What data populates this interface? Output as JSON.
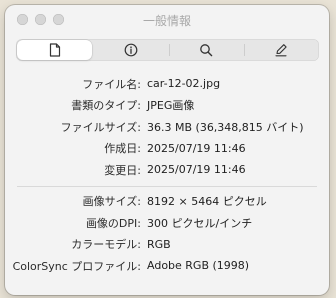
{
  "window": {
    "title": "一般情報"
  },
  "tabs": [
    {
      "name": "document",
      "icon": "document-icon"
    },
    {
      "name": "info",
      "icon": "info-icon"
    },
    {
      "name": "search",
      "icon": "magnifier-icon"
    },
    {
      "name": "edit",
      "icon": "pencil-icon"
    }
  ],
  "file_info": [
    {
      "label": "ファイル名:",
      "value": "car-12-02.jpg"
    },
    {
      "label": "書類のタイプ:",
      "value": "JPEG画像"
    },
    {
      "label": "ファイルサイズ:",
      "value": "36.3 MB (36,348,815 バイト)"
    },
    {
      "label": "作成日:",
      "value": "2025/07/19 11:46"
    },
    {
      "label": "変更日:",
      "value": "2025/07/19 11:46"
    }
  ],
  "image_info": [
    {
      "label": "画像サイズ:",
      "value": "8192 × 5464 ピクセル"
    },
    {
      "label": "画像のDPI:",
      "value": "300 ピクセル/インチ"
    },
    {
      "label": "カラーモデル:",
      "value": "RGB"
    },
    {
      "label": "ColorSync プロファイル:",
      "value": "Adobe RGB (1998)"
    }
  ]
}
